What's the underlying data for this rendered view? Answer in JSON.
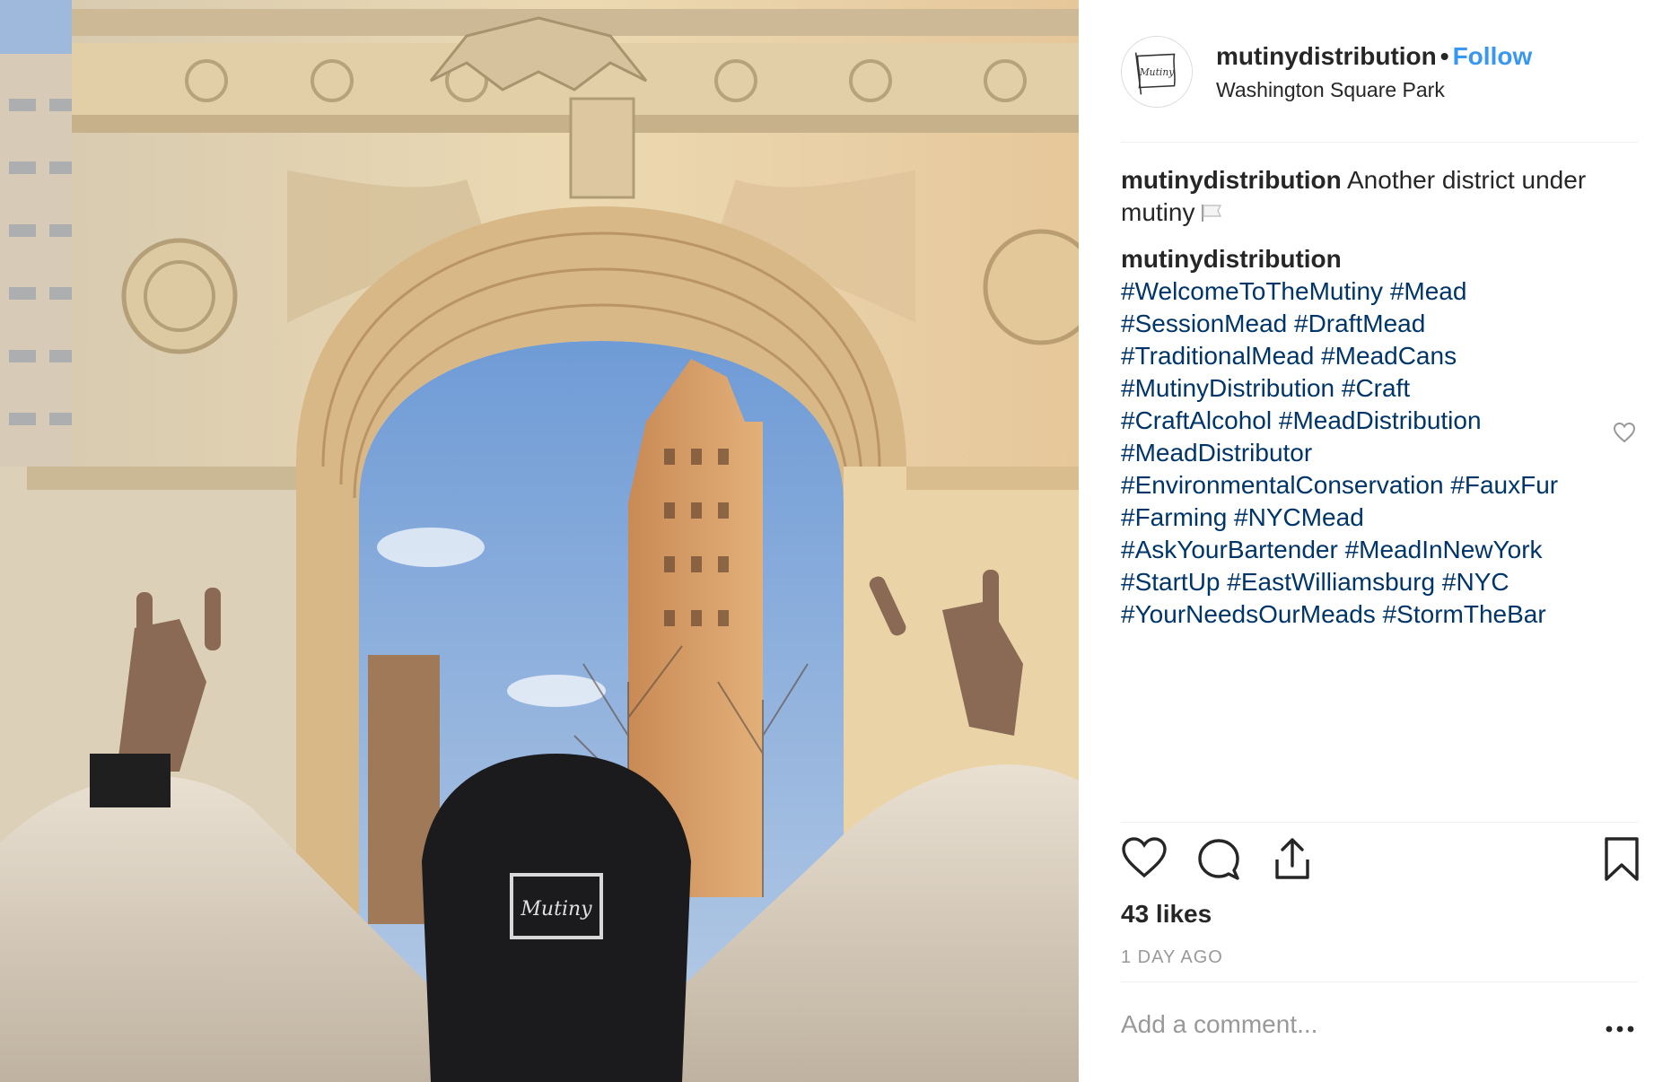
{
  "post": {
    "username": "mutinydistribution",
    "separator": "•",
    "follow_label": "Follow",
    "location": "Washington Square Park",
    "caption_user": "mutinydistribution",
    "caption_text": "Another district under mutiny",
    "comment_user": "mutinydistribution",
    "hashtags": [
      "#WelcomeToTheMutiny",
      "#Mead",
      "#SessionMead",
      "#DraftMead",
      "#TraditionalMead",
      "#MeadCans",
      "#MutinyDistribution",
      "#Craft",
      "#CraftAlcohol",
      "#MeadDistribution",
      "#MeadDistributor",
      "#EnvironmentalConservation",
      "#FauxFur",
      "#Farming",
      "#NYCMead",
      "#AskYourBartender",
      "#MeadInNewYork",
      "#StartUp",
      "#EastWilliamsburg",
      "#NYC",
      "#YourNeedsOurMeads",
      "#StormTheBar"
    ],
    "likes": "43 likes",
    "time": "1 DAY AGO",
    "comment_placeholder": "Add a comment...",
    "avatar_text": "Mutiny",
    "cap_logo_text": "Mutiny"
  },
  "icons": {
    "like": "heart-icon",
    "comment": "comment-bubble-icon",
    "share": "share-icon",
    "save": "bookmark-icon",
    "more": "more-dots-icon",
    "flag": "white-flag-icon"
  },
  "colors": {
    "link": "#003569",
    "follow": "#3897f0",
    "muted": "#999999",
    "text": "#262626"
  }
}
